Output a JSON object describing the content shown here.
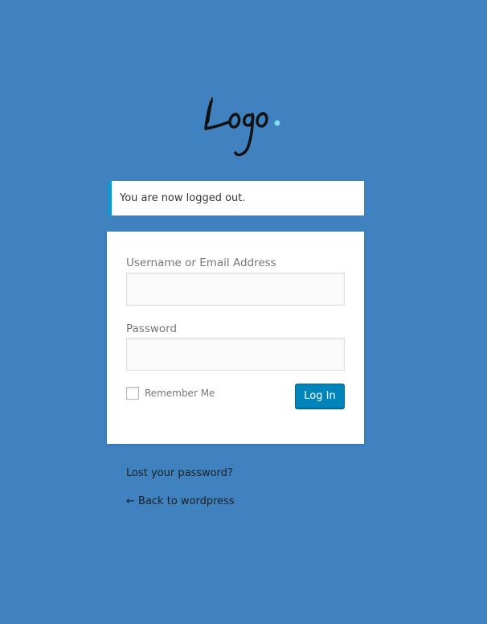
{
  "logo": {
    "icon": "logo-icon",
    "accent_color": "#7fe3f5"
  },
  "notice": {
    "message": "You are now logged out.",
    "accent_color": "#00a0d2"
  },
  "form": {
    "username_label": "Username or Email Address",
    "username_value": "",
    "password_label": "Password",
    "password_value": "",
    "remember_label": "Remember Me",
    "remember_checked": false,
    "submit_label": "Log In",
    "button_color": "#0085ba"
  },
  "links": {
    "lost_password": "Lost your password?",
    "back_to_site": "← Back to wordpress"
  },
  "colors": {
    "background": "#3f82bf"
  }
}
